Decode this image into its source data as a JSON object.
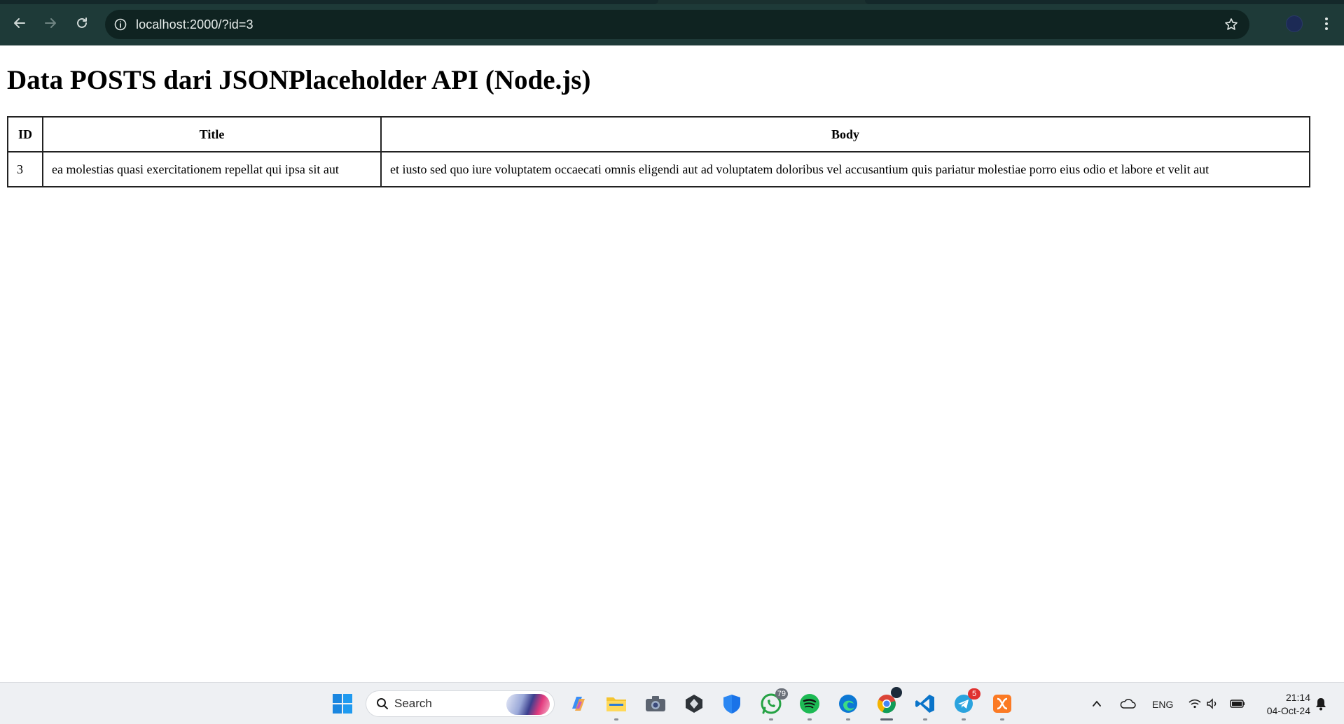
{
  "browser": {
    "url": "localhost:2000/?id=3"
  },
  "page": {
    "title": "Data POSTS dari JSONPlaceholder API (Node.js)",
    "table": {
      "headers": [
        "ID",
        "Title",
        "Body"
      ],
      "rows": [
        {
          "id": "3",
          "title": "ea molestias quasi exercitationem repellat qui ipsa sit aut",
          "body": "et iusto sed quo iure voluptatem occaecati omnis eligendi aut ad voluptatem doloribus vel accusantium quis pariatur molestiae porro eius odio et labore et velit aut"
        }
      ]
    }
  },
  "taskbar": {
    "search_label": "Search",
    "whatsapp_badge": "79",
    "telegram_badge": "5",
    "language": "ENG",
    "time": "21:14",
    "date": "04-Oct-24"
  },
  "colors": {
    "browser_bar": "#1e3a38",
    "omnibox": "#0f2321",
    "taskbar": "#eef0f3"
  }
}
